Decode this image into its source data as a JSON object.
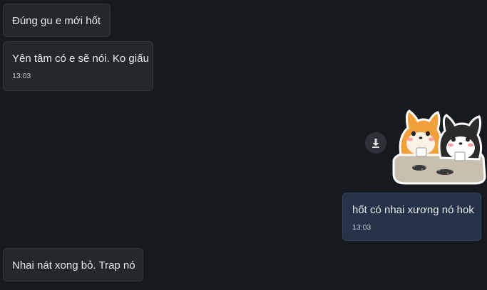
{
  "messages": [
    {
      "side": "incoming",
      "text": "Đúng gu e mới hốt",
      "time": ""
    },
    {
      "side": "incoming",
      "text": "Yên tâm có e sẽ nói. Ko giấu",
      "time": "13:03"
    },
    {
      "side": "outgoing",
      "text": "hốt có nhai xương nó hok",
      "time": "13:03"
    },
    {
      "side": "incoming",
      "text": "Nhai nát xong bỏ. Trap nó",
      "time": ""
    }
  ],
  "sticker": {
    "icon": "shiba-and-husky-eating-seeds-sticker",
    "download_icon": "download-icon"
  },
  "colors": {
    "background": "#16191e",
    "incoming_bubble": "#24272c",
    "outgoing_bubble": "#253248",
    "text": "#e6e8eb"
  }
}
